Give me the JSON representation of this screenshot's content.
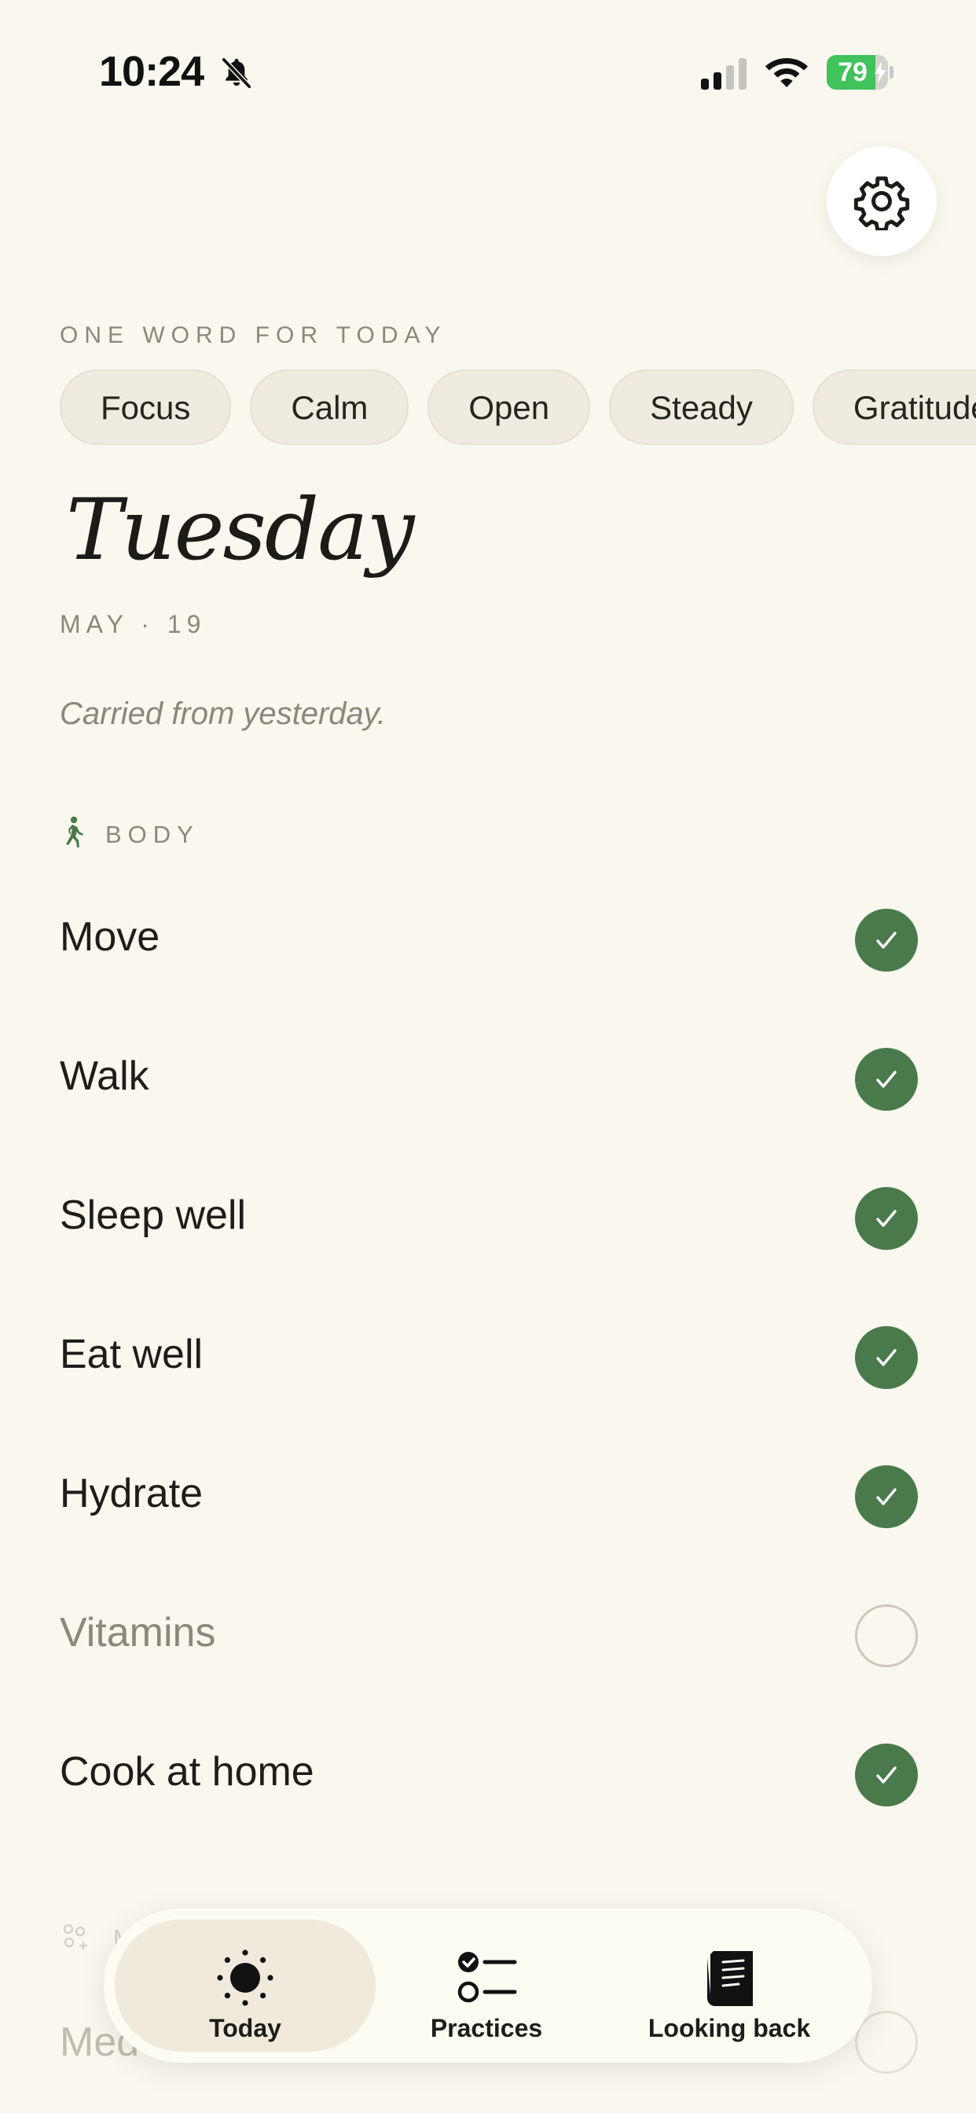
{
  "status_bar": {
    "time": "10:24",
    "battery": "79",
    "battery_level": 0.79
  },
  "header": {
    "eyebrow": "ONE WORD FOR TODAY",
    "words": [
      "Focus",
      "Calm",
      "Open",
      "Steady",
      "Gratitude"
    ],
    "day": "Tuesday",
    "date": "MAY · 19",
    "note": "Carried from yesterday."
  },
  "body_section": {
    "label": "BODY",
    "icon": "walking-icon",
    "habits": [
      {
        "label": "Move",
        "done": true
      },
      {
        "label": "Walk",
        "done": true
      },
      {
        "label": "Sleep well",
        "done": true
      },
      {
        "label": "Eat well",
        "done": true
      },
      {
        "label": "Hydrate",
        "done": true
      },
      {
        "label": "Vitamins",
        "done": false
      },
      {
        "label": "Cook at home",
        "done": true
      }
    ]
  },
  "next_section": {
    "label": "M",
    "first_item": "Med"
  },
  "tabbar": {
    "tabs": [
      {
        "label": "Today",
        "icon": "sun-icon",
        "active": true
      },
      {
        "label": "Practices",
        "icon": "checklist-icon",
        "active": false
      },
      {
        "label": "Looking back",
        "icon": "journal-icon",
        "active": false
      }
    ]
  },
  "colors": {
    "background": "#f9f7ee",
    "accent": "#4a7a4c",
    "muted": "#8c8877",
    "battery": "#3fc35a"
  }
}
